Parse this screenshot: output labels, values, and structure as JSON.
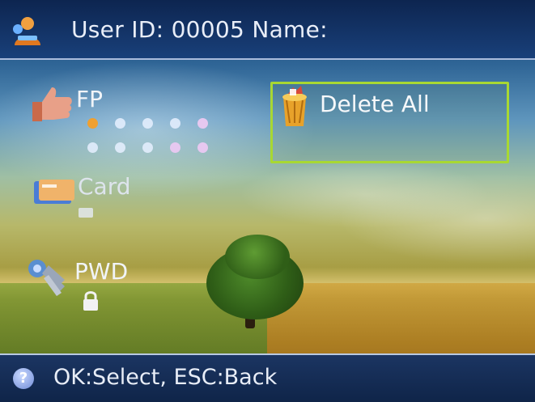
{
  "header": {
    "title": "User ID: 00005  Name:",
    "icon": "user-icon"
  },
  "menu": {
    "fp": {
      "label": "FP",
      "icon": "thumb-up-icon",
      "enrolled_dots_total": 10
    },
    "card": {
      "label": "Card",
      "icon": "card-icon"
    },
    "pwd": {
      "label": "PWD",
      "icon": "key-icon"
    }
  },
  "selected_option": {
    "label": "Delete All",
    "icon": "trash-bin-icon",
    "highlight_color": "#a8d832"
  },
  "footer": {
    "hint": "OK:Select, ESC:Back",
    "icon": "help-icon"
  }
}
